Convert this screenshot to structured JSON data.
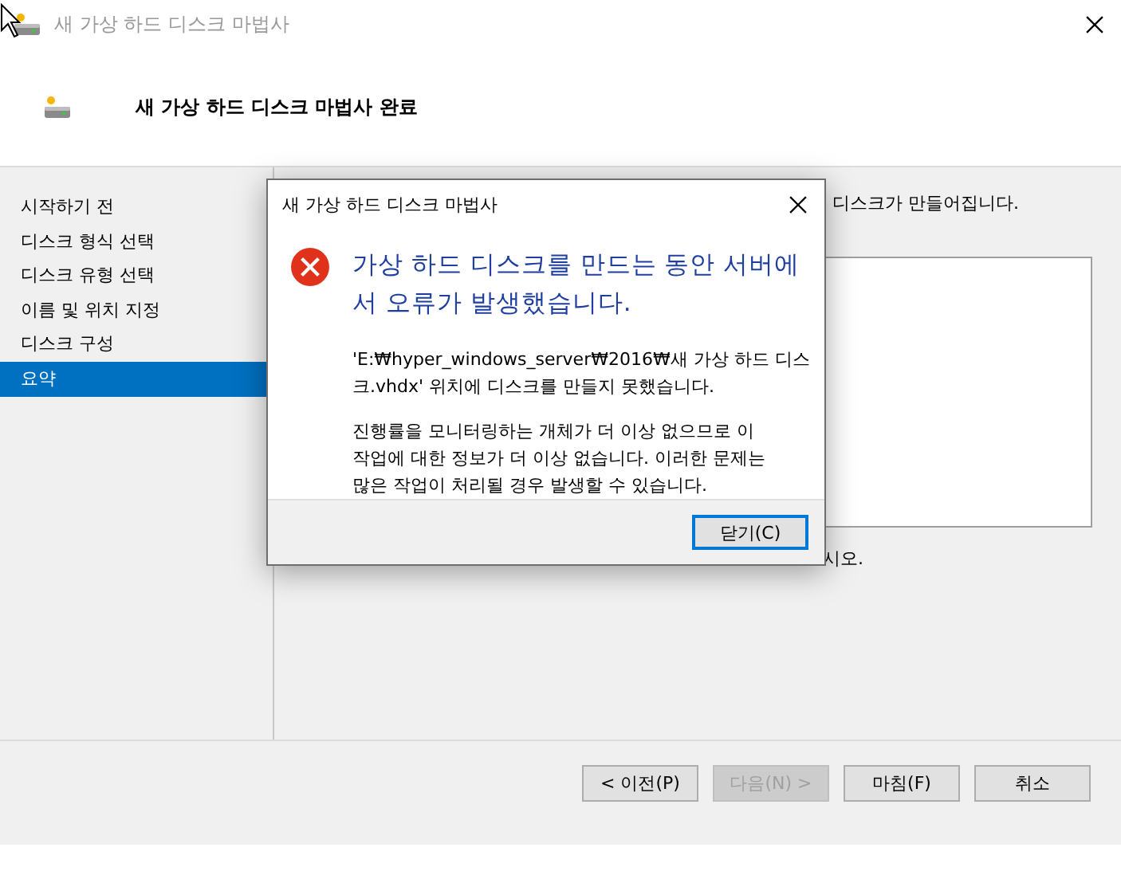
{
  "window": {
    "title": "새 가상 하드 디스크 마법사"
  },
  "header": {
    "title": "새 가상 하드 디스크 마법사 완료"
  },
  "sidebar": {
    "items": [
      {
        "label": "시작하기 전",
        "selected": false
      },
      {
        "label": "디스크 형식 선택",
        "selected": false
      },
      {
        "label": "디스크 유형 선택",
        "selected": false
      },
      {
        "label": "이름 및 위치 지정",
        "selected": false
      },
      {
        "label": "디스크 구성",
        "selected": false
      },
      {
        "label": "요약",
        "selected": true
      }
    ]
  },
  "content": {
    "intro_fragment": "디스크가 만들어집니다.",
    "instruction_fragment": "시오."
  },
  "buttons": [
    {
      "label": "< 이전(P)",
      "disabled": false
    },
    {
      "label": "다음(N) >",
      "disabled": true
    },
    {
      "label": "마침(F)",
      "disabled": false
    },
    {
      "label": "취소",
      "disabled": false
    }
  ],
  "dialog": {
    "title": "새 가상 하드 디스크 마법사",
    "heading": "가상 하드 디스크를 만드는 동안 서버에\n서 오류가 발생했습니다.",
    "messages": [
      "'E:₩hyper_windows_server₩2016₩새 가상 하드 디스\n크.vhdx' 위치에 디스크를 만들지 못했습니다.",
      "진행률을 모니터링하는 개체가 더 이상 없으므로 이\n작업에 대한 정보가 더 이상 없습니다. 이러한 문제는\n많은 작업이 처리될 경우 발생할 수 있습니다."
    ],
    "button": "닫기(C)"
  }
}
